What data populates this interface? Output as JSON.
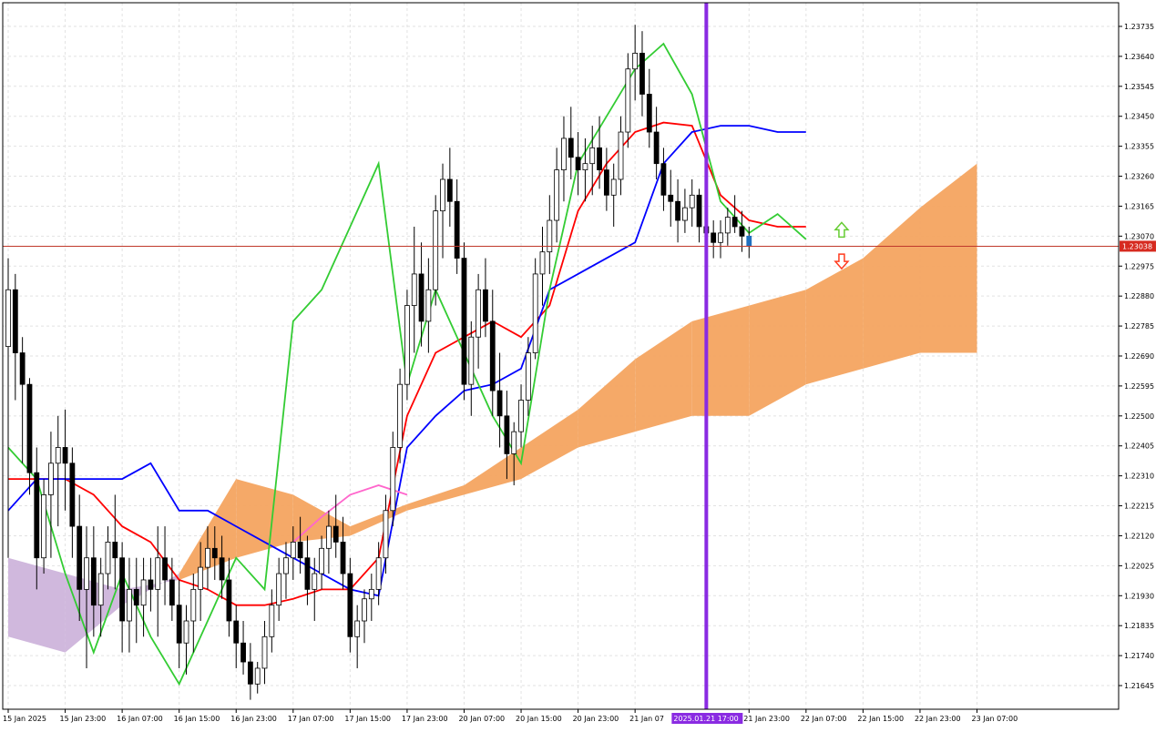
{
  "chart_data": {
    "type": "candlestick",
    "price_axis": {
      "labels": [
        "1.23735",
        "1.23640",
        "1.23545",
        "1.23450",
        "1.23355",
        "1.23260",
        "1.23165",
        "1.23070",
        "1.22975",
        "1.22880",
        "1.22785",
        "1.22690",
        "1.22595",
        "1.22500",
        "1.22405",
        "1.22310",
        "1.22215",
        "1.22120",
        "1.22025",
        "1.21930",
        "1.21835",
        "1.21740",
        "1.21645"
      ],
      "range": [
        1.2157,
        1.2381
      ]
    },
    "time_axis": {
      "labels": [
        "15 Jan 2025",
        "15 Jan 23:00",
        "16 Jan 07:00",
        "16 Jan 15:00",
        "16 Jan 23:00",
        "17 Jan 07:00",
        "17 Jan 15:00",
        "17 Jan 23:00",
        "20 Jan 07:00",
        "20 Jan 15:00",
        "20 Jan 23:00",
        "21 Jan 07",
        "21 Jan 23:00",
        "22 Jan 07:00",
        "22 Jan 15:00",
        "22 Jan 23:00",
        "23 Jan 07:00"
      ],
      "label_bars": [
        0,
        8,
        16,
        24,
        32,
        40,
        48,
        56,
        64,
        72,
        80,
        88,
        104,
        112,
        120,
        128,
        136
      ]
    },
    "current_price": {
      "label": "1.23038",
      "value": 1.23038
    },
    "cursor": {
      "label": "2025.01.21 17:00",
      "bar": 98
    },
    "candles": [
      [
        1.2272,
        1.23,
        1.2205,
        1.229
      ],
      [
        1.229,
        1.2295,
        1.2255,
        1.227
      ],
      [
        1.227,
        1.2275,
        1.2235,
        1.226
      ],
      [
        1.226,
        1.2262,
        1.2225,
        1.2232
      ],
      [
        1.2232,
        1.224,
        1.2195,
        1.2205
      ],
      [
        1.2205,
        1.223,
        1.22,
        1.2225
      ],
      [
        1.2225,
        1.2245,
        1.2205,
        1.2235
      ],
      [
        1.2235,
        1.225,
        1.2215,
        1.224
      ],
      [
        1.224,
        1.2252,
        1.222,
        1.2235
      ],
      [
        1.2235,
        1.224,
        1.2205,
        1.2215
      ],
      [
        1.2215,
        1.2225,
        1.2185,
        1.2195
      ],
      [
        1.2195,
        1.2215,
        1.217,
        1.2205
      ],
      [
        1.2205,
        1.2215,
        1.218,
        1.219
      ],
      [
        1.219,
        1.2205,
        1.218,
        1.22
      ],
      [
        1.22,
        1.2215,
        1.2195,
        1.221
      ],
      [
        1.221,
        1.2225,
        1.2195,
        1.2205
      ],
      [
        1.2205,
        1.221,
        1.2175,
        1.2185
      ],
      [
        1.2185,
        1.2205,
        1.2175,
        1.2195
      ],
      [
        1.2195,
        1.2205,
        1.2178,
        1.219
      ],
      [
        1.219,
        1.2205,
        1.218,
        1.2198
      ],
      [
        1.2198,
        1.2205,
        1.2188,
        1.2195
      ],
      [
        1.2195,
        1.2215,
        1.218,
        1.2205
      ],
      [
        1.2205,
        1.2215,
        1.219,
        1.2198
      ],
      [
        1.2198,
        1.2205,
        1.2185,
        1.219
      ],
      [
        1.219,
        1.2198,
        1.217,
        1.2178
      ],
      [
        1.2178,
        1.219,
        1.2168,
        1.2185
      ],
      [
        1.2185,
        1.22,
        1.2175,
        1.2195
      ],
      [
        1.2195,
        1.221,
        1.2185,
        1.2202
      ],
      [
        1.2202,
        1.2215,
        1.2195,
        1.2208
      ],
      [
        1.2208,
        1.2215,
        1.2198,
        1.2205
      ],
      [
        1.2205,
        1.2212,
        1.2192,
        1.2198
      ],
      [
        1.2198,
        1.2205,
        1.218,
        1.2185
      ],
      [
        1.2185,
        1.219,
        1.217,
        1.2178
      ],
      [
        1.2178,
        1.2185,
        1.2168,
        1.2172
      ],
      [
        1.2172,
        1.2178,
        1.216,
        1.2165
      ],
      [
        1.2165,
        1.2172,
        1.2162,
        1.217
      ],
      [
        1.217,
        1.2185,
        1.2165,
        1.218
      ],
      [
        1.218,
        1.2195,
        1.2175,
        1.219
      ],
      [
        1.219,
        1.2205,
        1.2185,
        1.22
      ],
      [
        1.22,
        1.221,
        1.2192,
        1.2205
      ],
      [
        1.2205,
        1.2215,
        1.2198,
        1.221
      ],
      [
        1.221,
        1.2218,
        1.22,
        1.2205
      ],
      [
        1.2205,
        1.2212,
        1.219,
        1.2195
      ],
      [
        1.2195,
        1.2205,
        1.2185,
        1.22
      ],
      [
        1.22,
        1.2212,
        1.2195,
        1.2208
      ],
      [
        1.2208,
        1.222,
        1.22,
        1.2215
      ],
      [
        1.2215,
        1.2225,
        1.2205,
        1.221
      ],
      [
        1.221,
        1.2218,
        1.2195,
        1.22
      ],
      [
        1.22,
        1.2205,
        1.2175,
        1.218
      ],
      [
        1.218,
        1.219,
        1.217,
        1.2185
      ],
      [
        1.2185,
        1.2195,
        1.2178,
        1.2192
      ],
      [
        1.2192,
        1.22,
        1.2185,
        1.2195
      ],
      [
        1.2195,
        1.221,
        1.219,
        1.2205
      ],
      [
        1.2205,
        1.2225,
        1.22,
        1.222
      ],
      [
        1.222,
        1.2245,
        1.2215,
        1.224
      ],
      [
        1.224,
        1.2265,
        1.2235,
        1.226
      ],
      [
        1.226,
        1.229,
        1.2255,
        1.2285
      ],
      [
        1.2285,
        1.231,
        1.227,
        1.2295
      ],
      [
        1.2295,
        1.2305,
        1.2272,
        1.228
      ],
      [
        1.228,
        1.23,
        1.227,
        1.229
      ],
      [
        1.229,
        1.232,
        1.2285,
        1.2315
      ],
      [
        1.2315,
        1.233,
        1.23,
        1.2325
      ],
      [
        1.2325,
        1.2335,
        1.231,
        1.2318
      ],
      [
        1.2318,
        1.2325,
        1.2295,
        1.23
      ],
      [
        1.23,
        1.2305,
        1.2255,
        1.226
      ],
      [
        1.226,
        1.228,
        1.225,
        1.2275
      ],
      [
        1.2275,
        1.2295,
        1.2265,
        1.229
      ],
      [
        1.229,
        1.23,
        1.2275,
        1.228
      ],
      [
        1.228,
        1.229,
        1.225,
        1.2258
      ],
      [
        1.2258,
        1.227,
        1.224,
        1.225
      ],
      [
        1.225,
        1.2258,
        1.223,
        1.2238
      ],
      [
        1.2238,
        1.2248,
        1.2228,
        1.2245
      ],
      [
        1.2245,
        1.226,
        1.224,
        1.2255
      ],
      [
        1.2255,
        1.2275,
        1.225,
        1.227
      ],
      [
        1.227,
        1.23,
        1.2268,
        1.2295
      ],
      [
        1.2295,
        1.231,
        1.2285,
        1.2302
      ],
      [
        1.2302,
        1.232,
        1.2295,
        1.2312
      ],
      [
        1.2312,
        1.2335,
        1.2305,
        1.2328
      ],
      [
        1.2328,
        1.2345,
        1.2318,
        1.2338
      ],
      [
        1.2338,
        1.2348,
        1.2325,
        1.2332
      ],
      [
        1.2332,
        1.234,
        1.232,
        1.2328
      ],
      [
        1.2328,
        1.2338,
        1.2318,
        1.233
      ],
      [
        1.233,
        1.2342,
        1.232,
        1.2335
      ],
      [
        1.2335,
        1.2345,
        1.2322,
        1.2328
      ],
      [
        1.2328,
        1.2335,
        1.2315,
        1.232
      ],
      [
        1.232,
        1.233,
        1.231,
        1.2325
      ],
      [
        1.2325,
        1.2345,
        1.232,
        1.234
      ],
      [
        1.234,
        1.2365,
        1.2335,
        1.236
      ],
      [
        1.236,
        1.2374,
        1.235,
        1.2365
      ],
      [
        1.2365,
        1.2372,
        1.2345,
        1.2352
      ],
      [
        1.2352,
        1.236,
        1.2335,
        1.234
      ],
      [
        1.234,
        1.2348,
        1.2325,
        1.233
      ],
      [
        1.233,
        1.2335,
        1.2315,
        1.232
      ],
      [
        1.232,
        1.2328,
        1.231,
        1.2318
      ],
      [
        1.2318,
        1.2325,
        1.2305,
        1.2312
      ],
      [
        1.2312,
        1.2322,
        1.2308,
        1.2316
      ],
      [
        1.2316,
        1.2325,
        1.231,
        1.232
      ],
      [
        1.232,
        1.2322,
        1.2305,
        1.231
      ],
      [
        1.231,
        1.2315,
        1.2302,
        1.2308
      ],
      [
        1.2308,
        1.2312,
        1.23,
        1.2305
      ],
      [
        1.2305,
        1.2312,
        1.23,
        1.2308
      ],
      [
        1.2308,
        1.2316,
        1.2304,
        1.2313
      ],
      [
        1.2313,
        1.232,
        1.2308,
        1.231
      ],
      [
        1.231,
        1.2315,
        1.2302,
        1.2307
      ],
      [
        1.2307,
        1.231,
        1.23,
        1.2304
      ]
    ],
    "lines": [
      {
        "id": "tenkan",
        "color": "#ff0000",
        "points": [
          [
            0,
            1.223
          ],
          [
            4,
            1.223
          ],
          [
            8,
            1.223
          ],
          [
            12,
            1.2225
          ],
          [
            16,
            1.2215
          ],
          [
            20,
            1.221
          ],
          [
            24,
            1.2198
          ],
          [
            28,
            1.2195
          ],
          [
            32,
            1.219
          ],
          [
            36,
            1.219
          ],
          [
            40,
            1.2192
          ],
          [
            44,
            1.2195
          ],
          [
            48,
            1.2195
          ],
          [
            52,
            1.2205
          ],
          [
            56,
            1.225
          ],
          [
            60,
            1.227
          ],
          [
            64,
            1.2275
          ],
          [
            68,
            1.228
          ],
          [
            72,
            1.2275
          ],
          [
            76,
            1.2285
          ],
          [
            80,
            1.2315
          ],
          [
            84,
            1.233
          ],
          [
            88,
            1.234
          ],
          [
            92,
            1.2343
          ],
          [
            96,
            1.2342
          ],
          [
            100,
            1.232
          ],
          [
            104,
            1.2312
          ],
          [
            108,
            1.231
          ],
          [
            112,
            1.231
          ]
        ]
      },
      {
        "id": "kijun",
        "color": "#0000ff",
        "points": [
          [
            0,
            1.222
          ],
          [
            4,
            1.223
          ],
          [
            8,
            1.223
          ],
          [
            12,
            1.223
          ],
          [
            16,
            1.223
          ],
          [
            20,
            1.2235
          ],
          [
            24,
            1.222
          ],
          [
            28,
            1.222
          ],
          [
            32,
            1.2215
          ],
          [
            36,
            1.221
          ],
          [
            40,
            1.2205
          ],
          [
            44,
            1.22
          ],
          [
            48,
            1.2195
          ],
          [
            52,
            1.2193
          ],
          [
            56,
            1.224
          ],
          [
            60,
            1.225
          ],
          [
            64,
            1.2258
          ],
          [
            68,
            1.226
          ],
          [
            72,
            1.2265
          ],
          [
            76,
            1.229
          ],
          [
            80,
            1.2295
          ],
          [
            84,
            1.23
          ],
          [
            88,
            1.2305
          ],
          [
            92,
            1.233
          ],
          [
            96,
            1.234
          ],
          [
            100,
            1.2342
          ],
          [
            104,
            1.2342
          ],
          [
            108,
            1.234
          ],
          [
            112,
            1.234
          ]
        ]
      },
      {
        "id": "chikou",
        "color": "#33cc33",
        "points": [
          [
            0,
            1.224
          ],
          [
            4,
            1.223
          ],
          [
            8,
            1.22
          ],
          [
            12,
            1.2175
          ],
          [
            16,
            1.22
          ],
          [
            20,
            1.218
          ],
          [
            24,
            1.2165
          ],
          [
            28,
            1.2185
          ],
          [
            32,
            1.2205
          ],
          [
            36,
            1.2195
          ],
          [
            40,
            1.228
          ],
          [
            44,
            1.229
          ],
          [
            48,
            1.231
          ],
          [
            52,
            1.233
          ],
          [
            56,
            1.226
          ],
          [
            60,
            1.229
          ],
          [
            64,
            1.227
          ],
          [
            68,
            1.225
          ],
          [
            72,
            1.2235
          ],
          [
            76,
            1.229
          ],
          [
            80,
            1.233
          ],
          [
            84,
            1.2345
          ],
          [
            88,
            1.236
          ],
          [
            92,
            1.2368
          ],
          [
            96,
            1.2352
          ],
          [
            100,
            1.2318
          ],
          [
            104,
            1.2308
          ],
          [
            108,
            1.2314
          ],
          [
            112,
            1.2306
          ]
        ]
      },
      {
        "id": "signal",
        "color": "#ff66cc",
        "points": [
          [
            40,
            1.221
          ],
          [
            44,
            1.2218
          ],
          [
            48,
            1.2225
          ],
          [
            52,
            1.2228
          ],
          [
            56,
            1.2225
          ]
        ]
      }
    ],
    "clouds": [
      {
        "id": "span-a",
        "color": "#f4a460",
        "points": [
          [
            0,
            1.218
          ],
          [
            8,
            1.2175
          ],
          [
            16,
            1.219
          ],
          [
            24,
            1.22
          ],
          [
            32,
            1.223
          ],
          [
            40,
            1.2225
          ],
          [
            48,
            1.2215
          ],
          [
            56,
            1.2222
          ],
          [
            64,
            1.2228
          ],
          [
            72,
            1.224
          ],
          [
            80,
            1.2252
          ],
          [
            88,
            1.2268
          ],
          [
            96,
            1.228
          ],
          [
            104,
            1.2285
          ],
          [
            112,
            1.229
          ],
          [
            120,
            1.23
          ],
          [
            128,
            1.2316
          ],
          [
            136,
            1.233
          ]
        ]
      },
      {
        "id": "span-b",
        "color": "#cdb4db",
        "points": [
          [
            0,
            1.2205
          ],
          [
            8,
            1.22
          ],
          [
            16,
            1.2195
          ],
          [
            24,
            1.2198
          ],
          [
            32,
            1.2205
          ],
          [
            40,
            1.221
          ],
          [
            48,
            1.2212
          ],
          [
            56,
            1.222
          ],
          [
            64,
            1.2225
          ],
          [
            72,
            1.223
          ],
          [
            80,
            1.224
          ],
          [
            88,
            1.2245
          ],
          [
            96,
            1.225
          ],
          [
            104,
            1.225
          ],
          [
            112,
            1.226
          ],
          [
            120,
            1.2265
          ],
          [
            128,
            1.227
          ],
          [
            136,
            1.227
          ]
        ]
      }
    ],
    "markers": [
      {
        "kind": "up-arrow",
        "bar": 117,
        "price": 1.2309,
        "color": "#66cc33"
      },
      {
        "kind": "down-arrow",
        "bar": 117,
        "price": 1.2299,
        "color": "#ff3b1f"
      }
    ]
  }
}
